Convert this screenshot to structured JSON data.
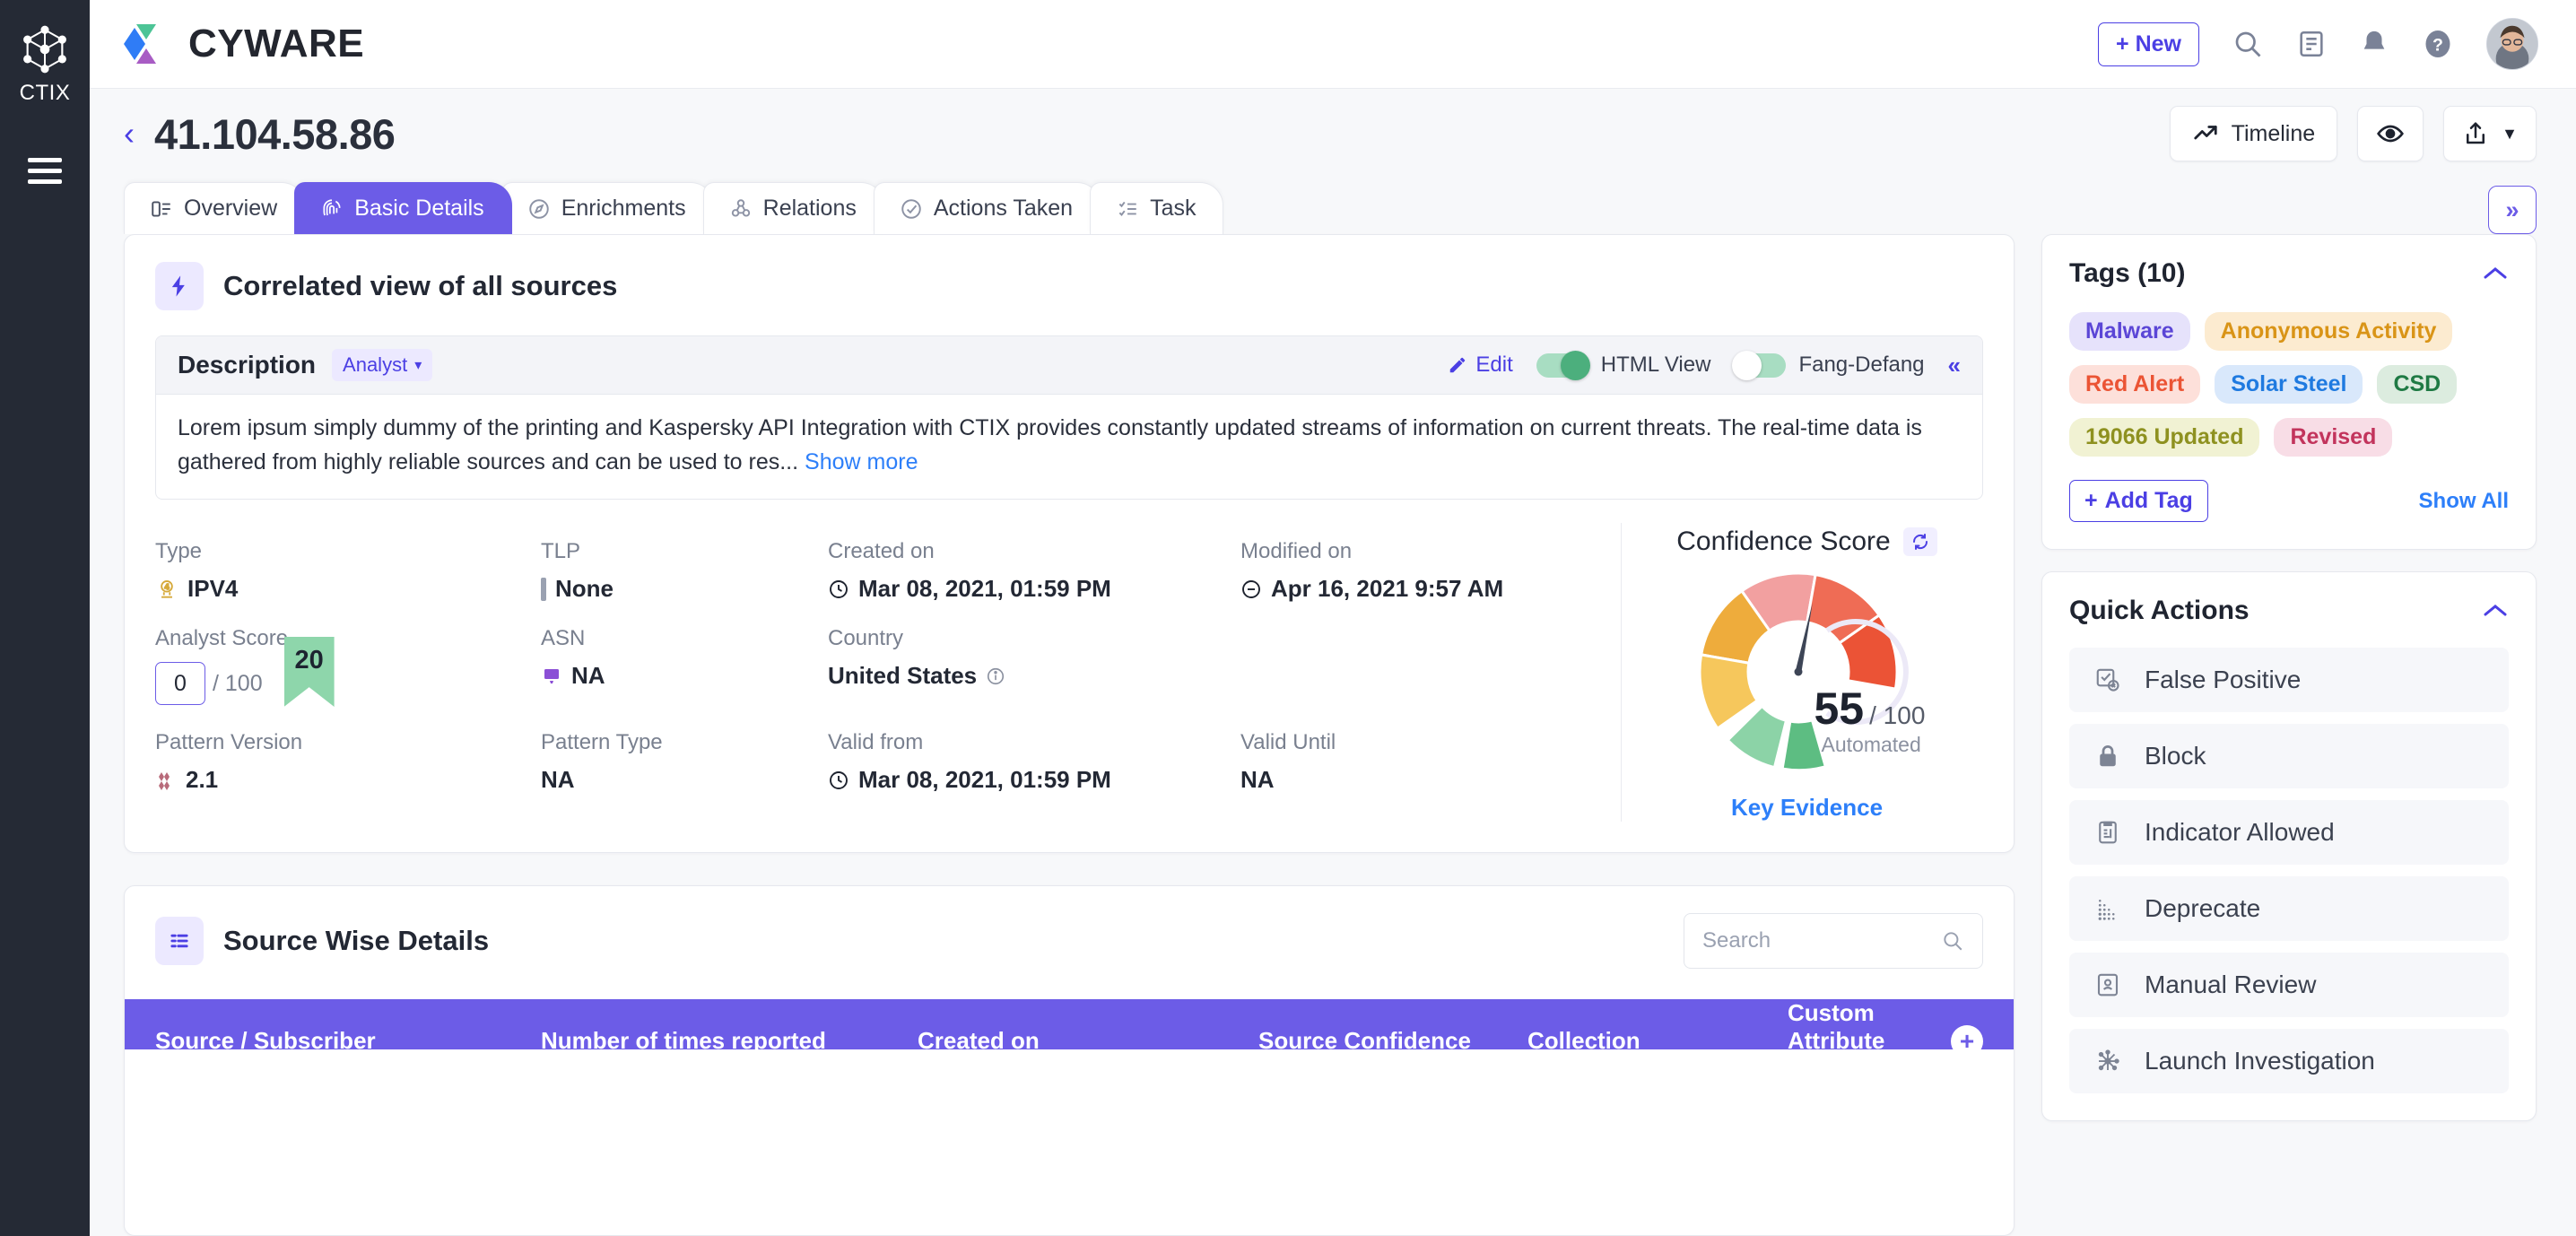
{
  "rail": {
    "product": "CTIX",
    "logo_icon": "cube-network-icon",
    "menu_icon": "hamburger-icon"
  },
  "header": {
    "brand": "CYWARE",
    "new_button": "+ New",
    "icons": [
      "search-icon",
      "notes-icon",
      "bell-icon",
      "help-icon"
    ],
    "avatar": "user-avatar"
  },
  "page": {
    "back_icon": "chevron-left-icon",
    "title": "41.104.58.86",
    "actions": [
      {
        "label": "Timeline",
        "icon": "trend-up-icon"
      },
      {
        "label": "",
        "icon": "eye-icon"
      },
      {
        "label": "",
        "icon": "share-icon"
      }
    ],
    "expand_button": "»"
  },
  "tabs": [
    {
      "label": "Overview",
      "icon": "layout-icon",
      "active": false
    },
    {
      "label": "Basic Details",
      "icon": "fingerprint-icon",
      "active": true
    },
    {
      "label": "Enrichments",
      "icon": "compass-icon",
      "active": false
    },
    {
      "label": "Relations",
      "icon": "relations-icon",
      "active": false
    },
    {
      "label": "Actions Taken",
      "icon": "check-circle-icon",
      "active": false
    },
    {
      "label": "Task",
      "icon": "task-list-icon",
      "active": false
    }
  ],
  "correlated": {
    "title": "Correlated view of all sources",
    "icon": "lightning-icon",
    "description": {
      "label": "Description",
      "source_chip": "Analyst",
      "edit_label": "Edit",
      "html_view_label": "HTML View",
      "html_view_on": true,
      "fang_defang_label": "Fang-Defang",
      "fang_defang_on": false,
      "collapse_icon": "chevrons-left-icon",
      "body": "Lorem ipsum simply dummy of the printing and Kaspersky API Integration with CTIX provides constantly updated streams of information on current threats. The real-time data is gathered from highly reliable sources and can be used to res...",
      "show_more": "Show more"
    },
    "fields_row1": [
      {
        "label": "Type",
        "value": "IPV4",
        "icon": "ipv4-icon"
      },
      {
        "label": "TLP",
        "value": "None",
        "icon": "tlp-bar-icon"
      },
      {
        "label": "Created on",
        "value": "Mar 08, 2021, 01:59 PM",
        "icon": "clock-icon"
      },
      {
        "label": "Modified on",
        "value": "Apr 16, 2021 9:57 AM",
        "icon": "clock-minus-icon"
      }
    ],
    "fields_row2": {
      "analyst_score": {
        "label": "Analyst Score",
        "value": "0",
        "denominator": "/ 100",
        "ribbon": "20"
      },
      "asn": {
        "label": "ASN",
        "value": "NA",
        "icon": "asn-icon"
      },
      "country": {
        "label": "Country",
        "value": "United States",
        "icon": "info-icon"
      }
    },
    "fields_row3": [
      {
        "label": "Pattern Version",
        "value": "2.1",
        "icon": "pattern-icon"
      },
      {
        "label": "Pattern Type",
        "value": "NA",
        "icon": ""
      },
      {
        "label": "Valid from",
        "value": "Mar 08, 2021, 01:59 PM",
        "icon": "clock-icon"
      },
      {
        "label": "Valid Until",
        "value": "NA",
        "icon": ""
      }
    ],
    "confidence": {
      "title": "Confidence Score",
      "refresh_icon": "refresh-icon",
      "score": "55",
      "denominator": "/ 100",
      "sub": "Automated",
      "key_evidence": "Key Evidence"
    }
  },
  "tags_panel": {
    "title": "Tags (10)",
    "collapse_icon": "chevron-up-icon",
    "tags": [
      {
        "label": "Malware",
        "bg": "#e6e2fb",
        "fg": "#5b46d6"
      },
      {
        "label": "Anonymous Activity",
        "bg": "#fcebd0",
        "fg": "#d99417"
      },
      {
        "label": "Red Alert",
        "bg": "#fde0da",
        "fg": "#eb5434"
      },
      {
        "label": "Solar Steel",
        "bg": "#d9e8fb",
        "fg": "#1f7ae0"
      },
      {
        "label": "CSD",
        "bg": "#dcecdf",
        "fg": "#1f7a44"
      },
      {
        "label": "19066 Updated",
        "bg": "#f1f2d3",
        "fg": "#8e9120"
      },
      {
        "label": "Revised",
        "bg": "#f8dde6",
        "fg": "#c2345c"
      }
    ],
    "add_tag": "Add Tag",
    "show_all": "Show All"
  },
  "quick_actions": {
    "title": "Quick Actions",
    "collapse_icon": "chevron-up-icon",
    "items": [
      {
        "label": "False Positive",
        "icon": "false-positive-icon"
      },
      {
        "label": "Block",
        "icon": "lock-icon"
      },
      {
        "label": "Indicator Allowed",
        "icon": "clipboard-icon"
      },
      {
        "label": "Deprecate",
        "icon": "dots-fade-icon"
      },
      {
        "label": "Manual Review",
        "icon": "id-card-icon"
      },
      {
        "label": "Launch Investigation",
        "icon": "network-node-icon"
      }
    ]
  },
  "source_wise": {
    "title": "Source Wise Details",
    "icon": "list-icon",
    "search_placeholder": "Search",
    "search_value": "",
    "search_icon": "search-icon",
    "columns": [
      "Source / Subscriber",
      "Number of times reported",
      "Created on",
      "Source Confidence",
      "Collection",
      "Custom Attribute Count"
    ],
    "add_column_icon": "plus-circle-icon"
  },
  "colors": {
    "accent": "#6c5ce7",
    "link": "#2d7ff9",
    "brandPurple": "#4b3fe4"
  }
}
